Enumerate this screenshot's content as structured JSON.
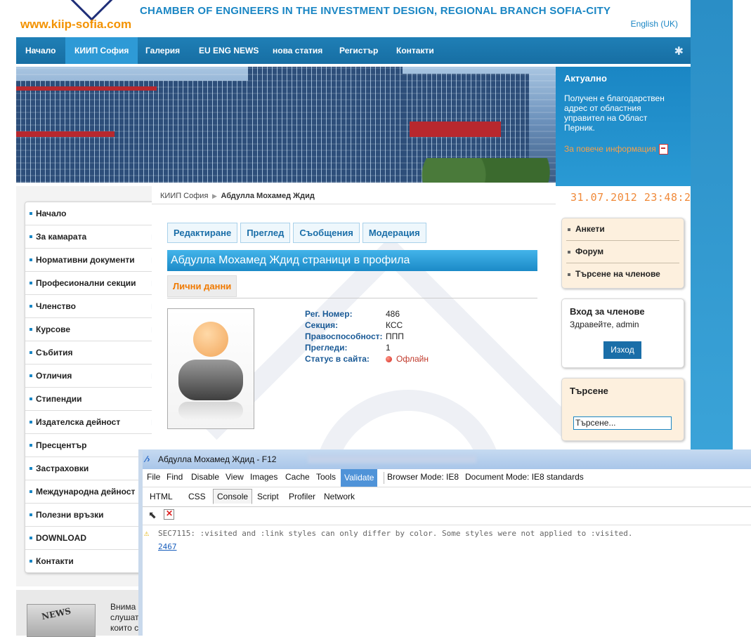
{
  "header": {
    "site_url": "www.kiip-sofia.com",
    "chamber_title": "CHAMBER OF ENGINEERS IN THE INVESTMENT DESIGN, REGIONAL BRANCH SOFIA-CITY",
    "language": "English (UK)"
  },
  "topnav": {
    "items": [
      "Начало",
      "КИИП София",
      "Галерия",
      "EU ENG NEWS",
      "нова статия",
      "Регистър",
      "Контакти"
    ],
    "active_index": 1
  },
  "aktualno": {
    "title": "Актуално",
    "text": "Получен е благодарствен адрес от областния управител на  Област Перник.",
    "more_link": "За повече информация"
  },
  "breadcrumb": {
    "root": "КИИП София",
    "current": "Абдулла Мохамед Ждид"
  },
  "sidebar": {
    "items": [
      {
        "label": "Начало",
        "submenu": false
      },
      {
        "label": "За камарата",
        "submenu": true
      },
      {
        "label": "Нормативни документи",
        "submenu": true
      },
      {
        "label": "Професионални секции",
        "submenu": true
      },
      {
        "label": "Членство",
        "submenu": true
      },
      {
        "label": "Курсове",
        "submenu": true
      },
      {
        "label": "Събития",
        "submenu": false
      },
      {
        "label": "Отличия",
        "submenu": true
      },
      {
        "label": "Стипендии",
        "submenu": false
      },
      {
        "label": "Издателска дейност",
        "submenu": true
      },
      {
        "label": "Пресцентър",
        "submenu": false
      },
      {
        "label": "Застраховки",
        "submenu": false
      },
      {
        "label": "Международна дейност",
        "submenu": false
      },
      {
        "label": "Полезни връзки",
        "submenu": false
      },
      {
        "label": "DOWNLOAD",
        "submenu": false
      },
      {
        "label": "Контакти",
        "submenu": false
      }
    ]
  },
  "news_box": {
    "image_text": "NEWS",
    "text_lines": [
      "Внима",
      "слушат",
      "които с"
    ]
  },
  "profile": {
    "tabs": [
      "Редактиране",
      "Преглед",
      "Съобщения",
      "Модерация"
    ],
    "title": "Абдулла Мохамед Ждид страници в профила",
    "section_tab": "Лични данни",
    "fields": [
      {
        "label": "Рег. Номер:",
        "value": "486"
      },
      {
        "label": "Секция:",
        "value": "КСС"
      },
      {
        "label": "Правоспособност:",
        "value": "ППП"
      },
      {
        "label": "Прегледи:",
        "value": "1"
      },
      {
        "label": "Статус в сайта:",
        "value": "Офлайн"
      }
    ]
  },
  "clock": "31.07.2012 23:48:2",
  "right": {
    "links": [
      "Анкети",
      "Форум",
      "Търсене на членове"
    ],
    "login": {
      "title": "Вход за членове",
      "greeting": "Здравейте, admin",
      "button": "Изход"
    },
    "search": {
      "title": "Търсене",
      "value": "Търсене..."
    }
  },
  "devtools": {
    "title": "Абдулла Мохамед Ждид - F12",
    "menu": [
      "File",
      "Find",
      "Disable",
      "View",
      "Images",
      "Cache",
      "Tools",
      "Validate"
    ],
    "browser_mode": "Browser Mode: IE8",
    "document_mode": "Document Mode: IE8 standards",
    "tabs": [
      "HTML",
      "CSS",
      "Console",
      "Script",
      "Profiler",
      "Network"
    ],
    "selected_tab": "Console",
    "console": {
      "message": "SEC7115: :visited and :link styles can only differ by color. Some styles were not applied to :visited.",
      "link": "2467"
    }
  },
  "colors": {
    "brand_blue": "#1a86c4",
    "orange": "#f39200",
    "nav_dark": "#1f7fb6",
    "beige": "#fdf0de"
  }
}
